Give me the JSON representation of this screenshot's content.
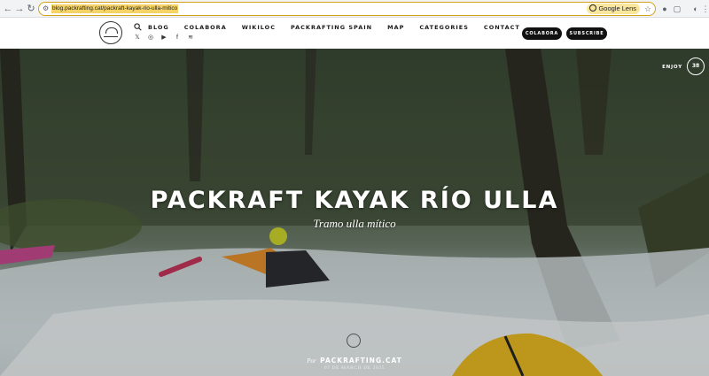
{
  "browser": {
    "url": "blog.packrafting.cat/packraft-kayak-rio-ulla-mitico",
    "lens_label": "Google Lens"
  },
  "header": {
    "menu": [
      "BLOG",
      "COLABORA",
      "WIKILOC",
      "PACKRAFTING SPAIN",
      "MAP",
      "CATEGORIES",
      "CONTACT"
    ],
    "colabora_button": "COLABORA",
    "subscribe_button": "SUBSCRIBE",
    "social_icons": [
      "x-icon",
      "instagram-icon",
      "youtube-icon",
      "facebook-icon",
      "rss-icon"
    ]
  },
  "hero": {
    "enjoy_label": "ENJOY",
    "enjoy_count": "38",
    "title": "PACKRAFT KAYAK RÍO ULLA",
    "subtitle": "Tramo ulla mítico",
    "byline_prefix": "Por",
    "author": "PACKRAFTING.CAT",
    "date": "07 DE MARCH DE 2025"
  },
  "colors": {
    "urlbar_border": "#d4a017",
    "button_bg": "#111111"
  }
}
